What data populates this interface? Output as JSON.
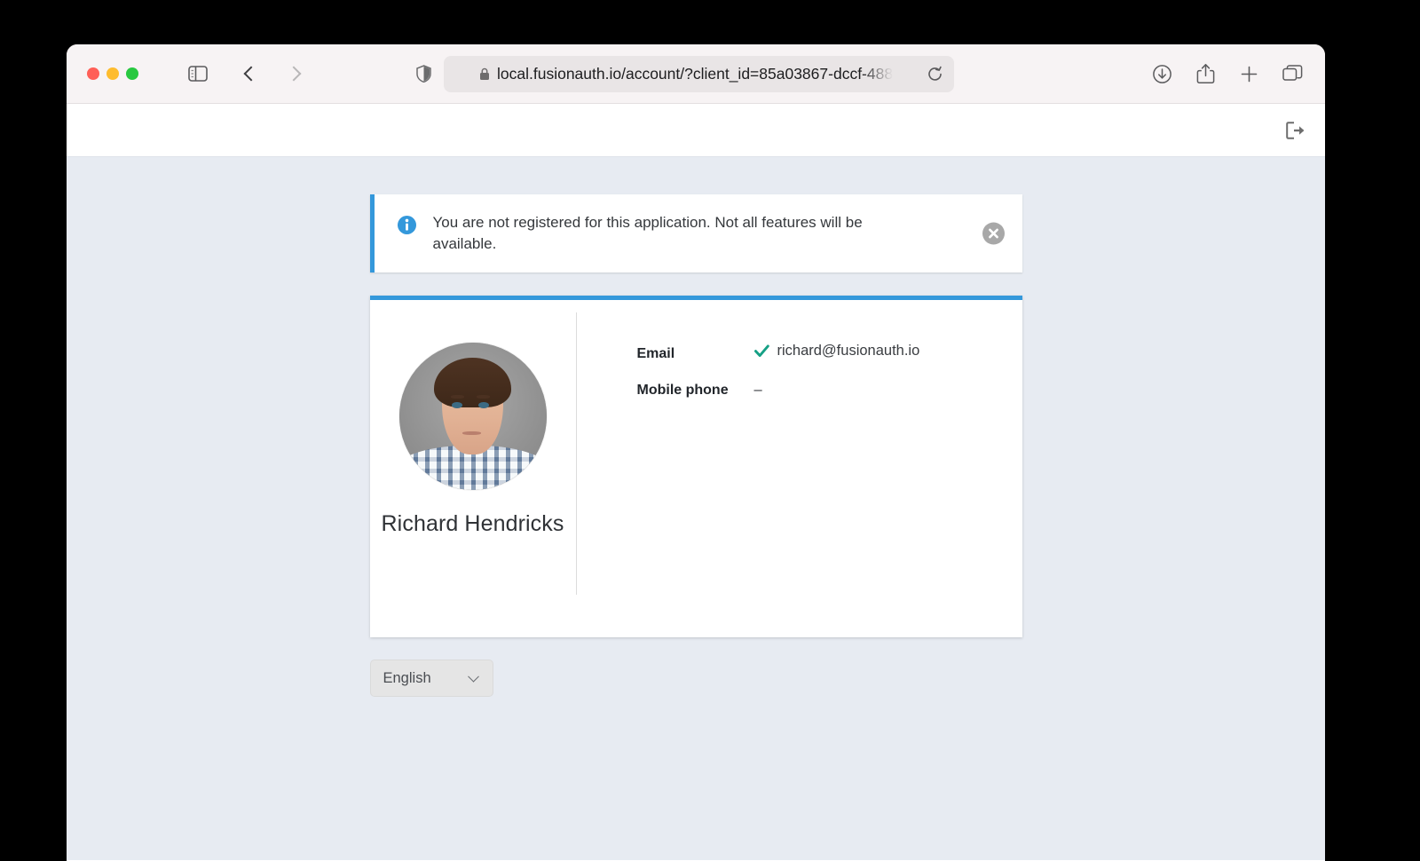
{
  "browser": {
    "traffic_lights": [
      "close",
      "minimize",
      "maximize"
    ],
    "sidebar_icon": "sidebar-toggle-icon",
    "back_icon": "back-chevron-icon",
    "forward_icon": "forward-chevron-icon",
    "shield_icon": "privacy-shield-icon",
    "lock_icon": "lock-icon",
    "url": "local.fusionauth.io/account/?client_id=85a03867-dccf-488",
    "reload_icon": "reload-icon",
    "downloads_icon": "downloads-icon",
    "share_icon": "share-icon",
    "new_tab_icon": "plus-icon",
    "tab_overview_icon": "tab-overview-icon"
  },
  "app_header": {
    "logout_icon": "logout-icon"
  },
  "alert": {
    "icon": "info-circle-icon",
    "message": "You are not registered for this application. Not all features will be available.",
    "close_icon": "close-circle-icon",
    "accent_color": "#3498db"
  },
  "profile": {
    "avatar_alt": "user-avatar",
    "name": "Richard Hendricks",
    "details": [
      {
        "label": "Email",
        "value": "richard@fusionauth.io",
        "verified": true
      },
      {
        "label": "Mobile phone",
        "value": "–",
        "verified": false
      }
    ],
    "verified_color": "#16a085"
  },
  "language_select": {
    "value": "English",
    "chevron_icon": "chevron-down-icon"
  }
}
